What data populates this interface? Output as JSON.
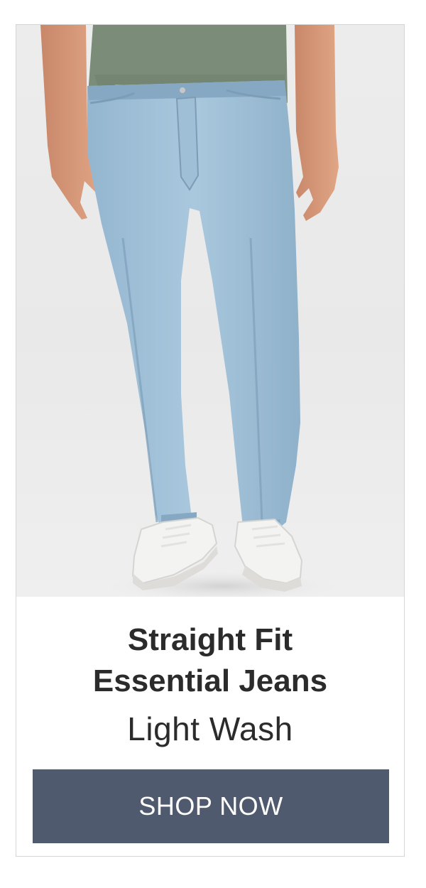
{
  "product": {
    "title_line1": "Straight Fit",
    "title_line2": "Essential Jeans",
    "variant": "Light Wash",
    "image_alt": "Man wearing light wash straight fit jeans and white sneakers"
  },
  "cta": {
    "label": "SHOP NOW"
  },
  "colors": {
    "button_bg": "#4f5a6e",
    "text": "#2b2b2b",
    "border": "#d6d6d6"
  }
}
